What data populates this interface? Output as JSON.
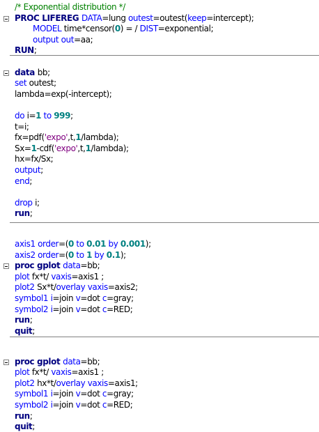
{
  "editor": {
    "colors": {
      "keyword": "#000080",
      "statement": "#0000ff",
      "number": "#008080",
      "string": "#800080",
      "comment": "#008000",
      "text": "#000000",
      "separator": "#808080"
    },
    "lines": [
      {
        "row": 0,
        "indent": 0,
        "tokens": [
          {
            "t": "/* Exponential distribution */",
            "c": "cmt"
          }
        ]
      },
      {
        "row": 1,
        "indent": 0,
        "fold": true,
        "tokens": [
          {
            "t": "PROC LIFEREG ",
            "c": "kw"
          },
          {
            "t": "DATA",
            "c": "stmt"
          },
          {
            "t": "=lung ",
            "c": "txt"
          },
          {
            "t": "outest",
            "c": "stmt"
          },
          {
            "t": "=outest(",
            "c": "txt"
          },
          {
            "t": "keep",
            "c": "stmt"
          },
          {
            "t": "=intercept);",
            "c": "txt"
          }
        ]
      },
      {
        "row": 2,
        "indent": 2,
        "tokens": [
          {
            "t": "MODEL ",
            "c": "stmt"
          },
          {
            "t": "time*censor(",
            "c": "txt"
          },
          {
            "t": "0",
            "c": "num"
          },
          {
            "t": ") = / ",
            "c": "txt"
          },
          {
            "t": "DIST",
            "c": "stmt"
          },
          {
            "t": "=exponential;",
            "c": "txt"
          }
        ]
      },
      {
        "row": 3,
        "indent": 2,
        "tokens": [
          {
            "t": "output out",
            "c": "stmt"
          },
          {
            "t": "=aa;",
            "c": "txt"
          }
        ]
      },
      {
        "row": 4,
        "indent": 0,
        "tokens": [
          {
            "t": "RUN",
            "c": "kw"
          },
          {
            "t": ";",
            "c": "txt"
          }
        ]
      },
      {
        "row": 6,
        "indent": 0,
        "fold": true,
        "tokens": [
          {
            "t": "data ",
            "c": "kw"
          },
          {
            "t": "bb;",
            "c": "txt"
          }
        ]
      },
      {
        "row": 7,
        "indent": 0,
        "tokens": [
          {
            "t": "set ",
            "c": "stmt"
          },
          {
            "t": "outest;",
            "c": "txt"
          }
        ]
      },
      {
        "row": 8,
        "indent": 0,
        "tokens": [
          {
            "t": "lambda=exp(-intercept);",
            "c": "txt"
          }
        ]
      },
      {
        "row": 10,
        "indent": 0,
        "tokens": [
          {
            "t": "do ",
            "c": "stmt"
          },
          {
            "t": "i=",
            "c": "txt"
          },
          {
            "t": "1",
            "c": "num"
          },
          {
            "t": " to ",
            "c": "stmt"
          },
          {
            "t": "999",
            "c": "num"
          },
          {
            "t": ";",
            "c": "txt"
          }
        ]
      },
      {
        "row": 11,
        "indent": 0,
        "tokens": [
          {
            "t": "t=i;",
            "c": "txt"
          }
        ]
      },
      {
        "row": 12,
        "indent": 0,
        "tokens": [
          {
            "t": "fx=pdf(",
            "c": "txt"
          },
          {
            "t": "'expo'",
            "c": "str"
          },
          {
            "t": ",t,",
            "c": "txt"
          },
          {
            "t": "1",
            "c": "num"
          },
          {
            "t": "/lambda);",
            "c": "txt"
          }
        ]
      },
      {
        "row": 13,
        "indent": 0,
        "tokens": [
          {
            "t": "Sx=",
            "c": "txt"
          },
          {
            "t": "1",
            "c": "num"
          },
          {
            "t": "-cdf(",
            "c": "txt"
          },
          {
            "t": "'expo'",
            "c": "str"
          },
          {
            "t": ",t,",
            "c": "txt"
          },
          {
            "t": "1",
            "c": "num"
          },
          {
            "t": "/lambda);",
            "c": "txt"
          }
        ]
      },
      {
        "row": 14,
        "indent": 0,
        "tokens": [
          {
            "t": "hx=fx/Sx;",
            "c": "txt"
          }
        ]
      },
      {
        "row": 15,
        "indent": 0,
        "tokens": [
          {
            "t": "output",
            "c": "stmt"
          },
          {
            "t": ";",
            "c": "txt"
          }
        ]
      },
      {
        "row": 16,
        "indent": 0,
        "tokens": [
          {
            "t": "end",
            "c": "stmt"
          },
          {
            "t": ";",
            "c": "txt"
          }
        ]
      },
      {
        "row": 18,
        "indent": 0,
        "tokens": [
          {
            "t": "drop ",
            "c": "stmt"
          },
          {
            "t": "i;",
            "c": "txt"
          }
        ]
      },
      {
        "row": 19,
        "indent": 0,
        "tokens": [
          {
            "t": "run",
            "c": "kw"
          },
          {
            "t": ";",
            "c": "txt"
          }
        ]
      },
      {
        "row": 21.8,
        "indent": 0,
        "tokens": [
          {
            "t": "axis1 order",
            "c": "stmt"
          },
          {
            "t": "=(",
            "c": "txt"
          },
          {
            "t": "0",
            "c": "num"
          },
          {
            "t": " to ",
            "c": "stmt"
          },
          {
            "t": "0.01",
            "c": "num"
          },
          {
            "t": " by ",
            "c": "stmt"
          },
          {
            "t": "0.001",
            "c": "num"
          },
          {
            "t": ");",
            "c": "txt"
          }
        ]
      },
      {
        "row": 22.8,
        "indent": 0,
        "tokens": [
          {
            "t": "axis2 order",
            "c": "stmt"
          },
          {
            "t": "=(",
            "c": "txt"
          },
          {
            "t": "0",
            "c": "num"
          },
          {
            "t": " to ",
            "c": "stmt"
          },
          {
            "t": "1",
            "c": "num"
          },
          {
            "t": " by ",
            "c": "stmt"
          },
          {
            "t": "0.1",
            "c": "num"
          },
          {
            "t": ");",
            "c": "txt"
          }
        ]
      },
      {
        "row": 23.8,
        "indent": 0,
        "fold": true,
        "tokens": [
          {
            "t": "proc gplot ",
            "c": "kw"
          },
          {
            "t": "data",
            "c": "stmt"
          },
          {
            "t": "=bb;",
            "c": "txt"
          }
        ]
      },
      {
        "row": 24.8,
        "indent": 0,
        "tokens": [
          {
            "t": "plot ",
            "c": "stmt"
          },
          {
            "t": "fx*t/ ",
            "c": "txt"
          },
          {
            "t": "vaxis",
            "c": "stmt"
          },
          {
            "t": "=axis1 ;",
            "c": "txt"
          }
        ]
      },
      {
        "row": 25.8,
        "indent": 0,
        "tokens": [
          {
            "t": "plot2 ",
            "c": "stmt"
          },
          {
            "t": "Sx*t/",
            "c": "txt"
          },
          {
            "t": "overlay vaxis",
            "c": "stmt"
          },
          {
            "t": "=axis2;",
            "c": "txt"
          }
        ]
      },
      {
        "row": 26.8,
        "indent": 0,
        "tokens": [
          {
            "t": "symbol1 i",
            "c": "stmt"
          },
          {
            "t": "=join ",
            "c": "txt"
          },
          {
            "t": "v",
            "c": "stmt"
          },
          {
            "t": "=dot ",
            "c": "txt"
          },
          {
            "t": "c",
            "c": "stmt"
          },
          {
            "t": "=gray;",
            "c": "txt"
          }
        ]
      },
      {
        "row": 27.8,
        "indent": 0,
        "tokens": [
          {
            "t": "symbol2 i",
            "c": "stmt"
          },
          {
            "t": "=join ",
            "c": "txt"
          },
          {
            "t": "v",
            "c": "stmt"
          },
          {
            "t": "=dot ",
            "c": "txt"
          },
          {
            "t": "c",
            "c": "stmt"
          },
          {
            "t": "=RED;",
            "c": "txt"
          }
        ]
      },
      {
        "row": 28.8,
        "indent": 0,
        "tokens": [
          {
            "t": "run",
            "c": "kw"
          },
          {
            "t": ";",
            "c": "txt"
          }
        ]
      },
      {
        "row": 29.8,
        "indent": 0,
        "tokens": [
          {
            "t": "quit",
            "c": "kw"
          },
          {
            "t": ";",
            "c": "txt"
          }
        ]
      },
      {
        "row": 32.6,
        "indent": 0,
        "fold": true,
        "tokens": [
          {
            "t": "proc gplot ",
            "c": "kw"
          },
          {
            "t": "data",
            "c": "stmt"
          },
          {
            "t": "=bb;",
            "c": "txt"
          }
        ]
      },
      {
        "row": 33.6,
        "indent": 0,
        "tokens": [
          {
            "t": "plot ",
            "c": "stmt"
          },
          {
            "t": "fx*t/ ",
            "c": "txt"
          },
          {
            "t": "vaxis",
            "c": "stmt"
          },
          {
            "t": "=axis1 ;",
            "c": "txt"
          }
        ]
      },
      {
        "row": 34.6,
        "indent": 0,
        "tokens": [
          {
            "t": "plot2 ",
            "c": "stmt"
          },
          {
            "t": "hx*t/",
            "c": "txt"
          },
          {
            "t": "overlay vaxis",
            "c": "stmt"
          },
          {
            "t": "=axis1;",
            "c": "txt"
          }
        ]
      },
      {
        "row": 35.6,
        "indent": 0,
        "tokens": [
          {
            "t": "symbol1 i",
            "c": "stmt"
          },
          {
            "t": "=join ",
            "c": "txt"
          },
          {
            "t": "v",
            "c": "stmt"
          },
          {
            "t": "=dot ",
            "c": "txt"
          },
          {
            "t": "c",
            "c": "stmt"
          },
          {
            "t": "=gray;",
            "c": "txt"
          }
        ]
      },
      {
        "row": 36.6,
        "indent": 0,
        "tokens": [
          {
            "t": "symbol2 i",
            "c": "stmt"
          },
          {
            "t": "=join ",
            "c": "txt"
          },
          {
            "t": "v",
            "c": "stmt"
          },
          {
            "t": "=dot ",
            "c": "txt"
          },
          {
            "t": "c",
            "c": "stmt"
          },
          {
            "t": "=RED;",
            "c": "txt"
          }
        ]
      },
      {
        "row": 37.6,
        "indent": 0,
        "tokens": [
          {
            "t": "run",
            "c": "kw"
          },
          {
            "t": ";",
            "c": "txt"
          }
        ]
      },
      {
        "row": 38.6,
        "indent": 0,
        "tokens": [
          {
            "t": "quit",
            "c": "kw"
          },
          {
            "t": ";",
            "c": "txt"
          }
        ]
      }
    ],
    "separators": [
      {
        "row": 5
      },
      {
        "row": 20.4
      },
      {
        "row": 30.9
      }
    ]
  }
}
